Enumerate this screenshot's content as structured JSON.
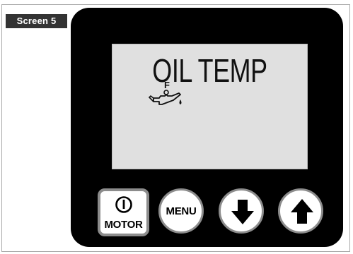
{
  "screen_tag": "Screen 5",
  "lcd": {
    "title": "OIL TEMP",
    "oil_scale_letter": "F",
    "icon": "oil-can-icon"
  },
  "buttons": {
    "motor_label": "MOTOR",
    "motor_icon": "power-icon",
    "menu_label": "MENU",
    "down_icon": "arrow-down-icon",
    "up_icon": "arrow-up-icon"
  },
  "colors": {
    "device_body": "#000000",
    "lcd_background": "#e0e0e0",
    "button_face": "#ffffff",
    "button_rim": "#8c8c8c",
    "tag_background": "#333333"
  }
}
